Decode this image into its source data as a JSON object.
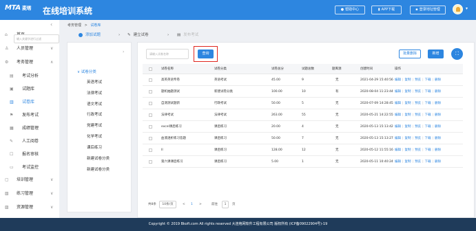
{
  "header": {
    "logo": "MTA",
    "logo_cn": "麦塔",
    "app_title": "在线培训系统",
    "help_label": "帮助中心",
    "app_download_label": "APP下载",
    "login_label": "登录地址管理"
  },
  "sidebar": {
    "items": [
      {
        "label": "首页",
        "icon": "home-icon"
      },
      {
        "label": "人员管理",
        "icon": "user-icon"
      },
      {
        "label": "考务管理",
        "icon": "exam-icon"
      },
      {
        "label": "考试分析",
        "icon": "chart-icon"
      },
      {
        "label": "试题库",
        "icon": "question-bank-icon"
      },
      {
        "label": "试卷库",
        "icon": "paper-library-icon"
      },
      {
        "label": "发布考试",
        "icon": "publish-icon"
      },
      {
        "label": "成绩管理",
        "icon": "score-icon"
      },
      {
        "label": "人工阅卷",
        "icon": "marking-icon"
      },
      {
        "label": "报名审核",
        "icon": "signup-icon"
      },
      {
        "label": "考试监控",
        "icon": "monitor-icon"
      },
      {
        "label": "培训管理",
        "icon": "training-icon"
      },
      {
        "label": "练习管理",
        "icon": "practice-icon"
      },
      {
        "label": "资源管理",
        "icon": "resource-icon"
      }
    ]
  },
  "breadcrumb": {
    "parent": "考务管理",
    "sep": ">",
    "current": "试卷库"
  },
  "steps": [
    {
      "label": "添加试题"
    },
    {
      "label": "建立试卷"
    },
    {
      "label": "发布考试"
    }
  ],
  "tree": {
    "filter_placeholder": "输入关键字进行过滤",
    "root": "试卷分类",
    "children": [
      "英语考试",
      "法律考试",
      "语文考试",
      "行政考试",
      "党建考试",
      "化学考试",
      "课后练习",
      "新建试卷分类",
      "新建试卷分类"
    ]
  },
  "toolbar": {
    "search_placeholder": "请输入试卷名称",
    "query_label": "查询",
    "batch_delete_label": "批量删除",
    "new_label": "新增"
  },
  "table": {
    "headers": [
      "试卷名称",
      "试卷分类",
      "试卷总分",
      "试题总数",
      "题库源",
      "创建时间",
      "操作"
    ],
    "rows": [
      {
        "name": "高英英语专卷",
        "category": "英语考试",
        "score": "45.00",
        "count": "9",
        "source": "无",
        "created": "2021-04-29 15:40:56"
      },
      {
        "name": "题机抽题测试",
        "category": "新建试卷分类",
        "score": "100.00",
        "count": "10",
        "source": "有",
        "created": "2020-08-04 11:23:44"
      },
      {
        "name": "自测测试题新",
        "category": "行政考试",
        "score": "50.00",
        "count": "5",
        "source": "无",
        "created": "2020-07-09 14:28:45"
      },
      {
        "name": "法律考试",
        "category": "法律考试",
        "score": "263.00",
        "count": "55",
        "source": "无",
        "created": "2020-05-21 14:22:55"
      },
      {
        "name": "excel课后练习",
        "category": "课后练习",
        "score": "20.00",
        "count": "4",
        "source": "无",
        "created": "2020-05-13 15:13:42"
      },
      {
        "name": "血液透析练习答题",
        "category": "课后练习",
        "score": "50.00",
        "count": "7",
        "source": "无",
        "created": "2020-05-13 15:13:27"
      },
      {
        "name": "II",
        "category": "课后练习",
        "score": "128.00",
        "count": "12",
        "source": "无",
        "created": "2020-05-12 11:55:16"
      },
      {
        "name": "第六课课后练习",
        "category": "课后练习",
        "score": "5.00",
        "count": "1",
        "source": "无",
        "created": "2020-05-11 10:40:24"
      }
    ],
    "actions": [
      "编辑",
      "复制",
      "预览",
      "下载",
      "删除"
    ]
  },
  "pager": {
    "total": "共8条",
    "page_size": "10条/页",
    "prev": "<",
    "current_page": "1",
    "next": ">",
    "goto_label": "前往",
    "goto_value": "1",
    "page_suffix": "页"
  },
  "footer": {
    "text": "Copyright © 2019 Bkoft.com All rights reserved 大连格网软件工程有限公司 版权所有 (ICP备09022904号)-19"
  },
  "colors": {
    "primary": "#2d86e0",
    "highlight": "#e0251e",
    "footer": "#1f3b5a"
  }
}
